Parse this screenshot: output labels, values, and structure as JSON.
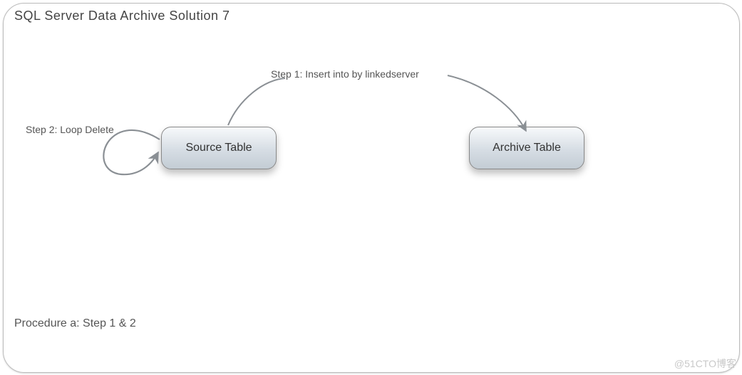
{
  "header": {
    "title": "SQL Server Data Archive Solution  7"
  },
  "labels": {
    "step1": "Step 1:  Insert into by linkedserver",
    "step2": "Step 2:  Loop Delete",
    "procedure": "Procedure a:  Step 1 & 2"
  },
  "nodes": {
    "source": "Source Table",
    "archive": "Archive Table"
  },
  "watermark": "@51CTO博客"
}
